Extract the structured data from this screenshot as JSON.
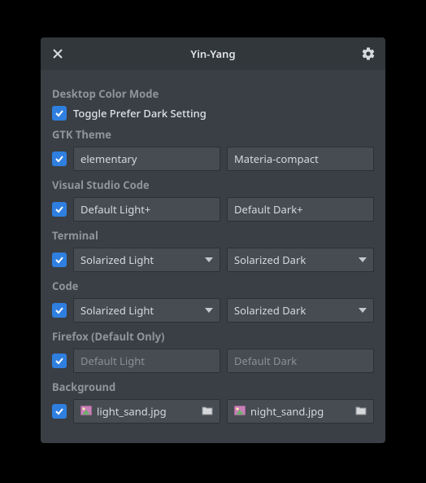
{
  "window": {
    "title": "Yin-Yang"
  },
  "icons": {
    "close": "close-icon",
    "gear": "gear-icon",
    "chevron_down": "chevron-down-icon",
    "image": "image-icon",
    "folder": "folder-icon",
    "check": "check-icon"
  },
  "colors": {
    "accent": "#2f7fe0",
    "window_bg": "#3a3f45",
    "titlebar_bg": "#32373c"
  },
  "sections": {
    "desktop": {
      "label": "Desktop Color Mode",
      "toggle_label": "Toggle Prefer Dark Setting",
      "checked": true
    },
    "gtk": {
      "label": "GTK Theme",
      "checked": true,
      "light": "elementary",
      "dark": "Materia-compact"
    },
    "vscode": {
      "label": "Visual Studio Code",
      "checked": true,
      "light": "Default Light+",
      "dark": "Default Dark+"
    },
    "terminal": {
      "label": "Terminal",
      "checked": true,
      "light": "Solarized Light",
      "dark": "Solarized Dark"
    },
    "code": {
      "label": "Code",
      "checked": true,
      "light": "Solarized Light",
      "dark": "Solarized Dark"
    },
    "firefox": {
      "label": "Firefox (Default Only)",
      "checked": true,
      "light_placeholder": "Default Light",
      "dark_placeholder": "Default Dark"
    },
    "background": {
      "label": "Background",
      "checked": true,
      "light": "light_sand.jpg",
      "dark": "night_sand.jpg"
    }
  }
}
